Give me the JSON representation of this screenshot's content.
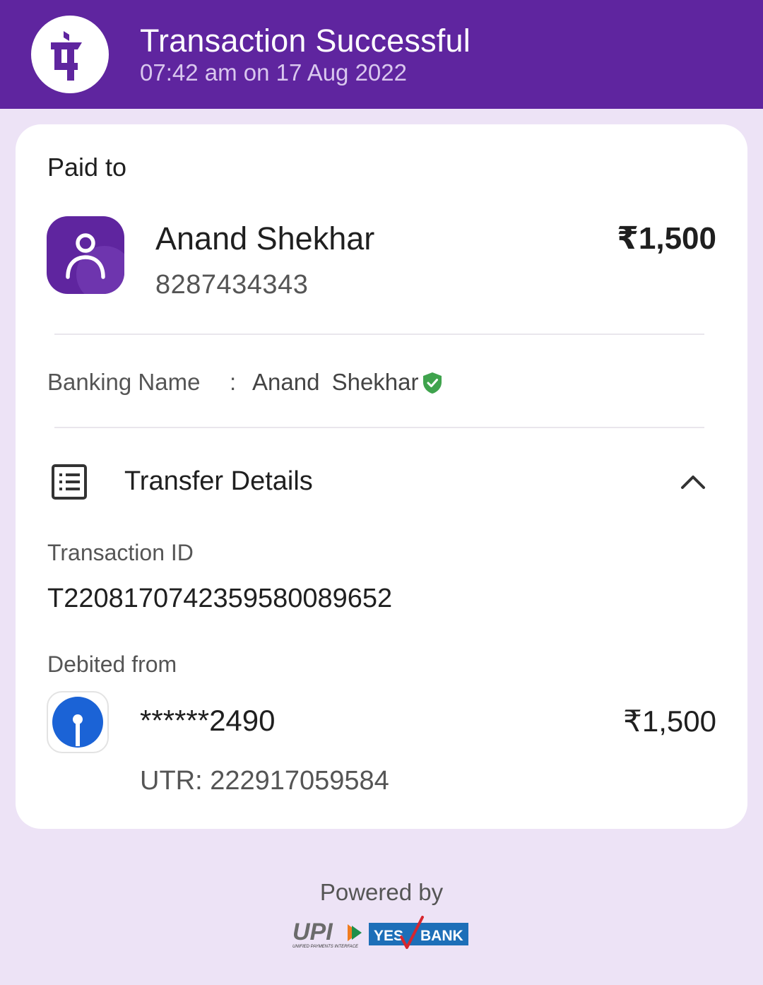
{
  "header": {
    "title": "Transaction Successful",
    "timestamp": "07:42 am on 17 Aug 2022",
    "logo_icon": "phonepe-logo-icon",
    "brand_color": "#5F259F"
  },
  "payee": {
    "section_label": "Paid to",
    "name": "Anand Shekhar",
    "phone": "8287434343",
    "amount": "₹1,500",
    "avatar_icon": "person-avatar-icon"
  },
  "banking": {
    "label": "Banking Name",
    "separator": ":",
    "name": "Anand  Shekhar",
    "verified_icon": "verified-shield-icon",
    "verified_color": "#3FA34D"
  },
  "transfer_details": {
    "title": "Transfer Details",
    "icon": "receipt-list-icon",
    "toggle_icon": "chevron-up-icon",
    "transaction_id_label": "Transaction ID",
    "transaction_id": "T2208170742359580089652",
    "debited_from_label": "Debited from",
    "account_masked": "******2490",
    "debit_amount": "₹1,500",
    "utr": "UTR: 222917059584",
    "bank_icon": "sbi-bank-logo-icon"
  },
  "footer": {
    "powered_by": "Powered by",
    "upi_text": "UPI",
    "upi_subtext": "UNIFIED PAYMENTS INTERFACE",
    "bank_logo_yes": "YES",
    "bank_logo_bank": "BANK",
    "bank_color": "#1D6FB8"
  }
}
